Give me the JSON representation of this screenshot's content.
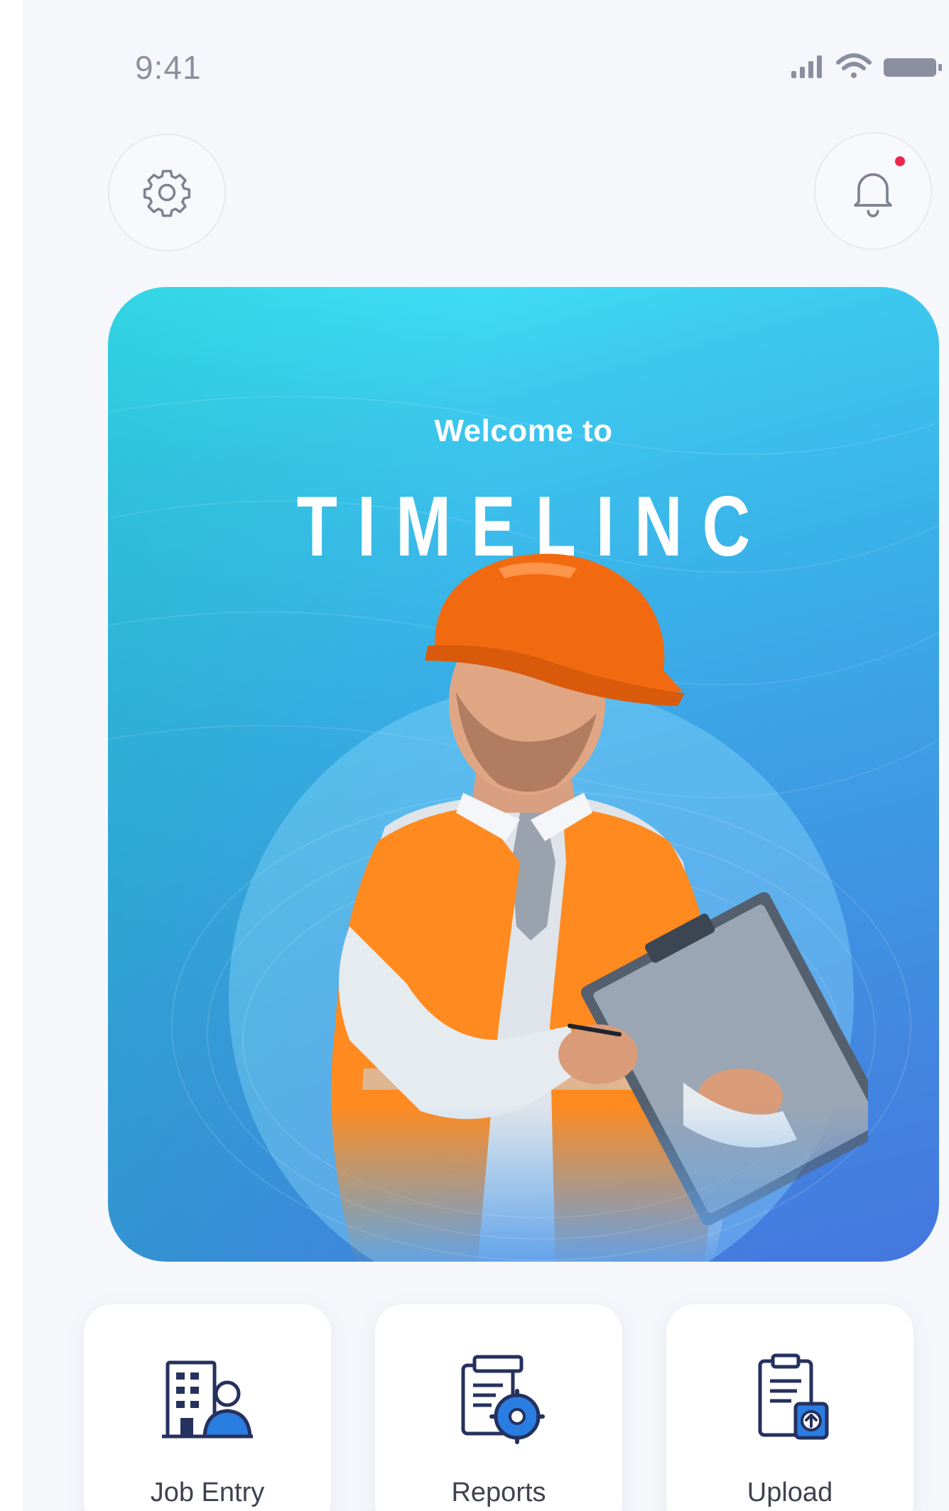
{
  "status_bar": {
    "time": "9:41",
    "icons": [
      "signal-icon",
      "wifi-icon",
      "battery-icon"
    ]
  },
  "header": {
    "left_button_icon": "gear-icon",
    "right_button_icon": "bell-icon",
    "has_notification": true
  },
  "hero": {
    "welcome": "Welcome to",
    "brand": "TIMELINC",
    "image": "construction worker with hard hat and clipboard"
  },
  "tiles": [
    {
      "label": "Job Entry",
      "icon": "job-entry-icon"
    },
    {
      "label": "Reports",
      "icon": "reports-icon"
    },
    {
      "label": "Upload",
      "icon": "upload-icon"
    }
  ],
  "colors": {
    "background": "#f6f7fb",
    "hero_top": "#43ecfb",
    "hero_bottom": "#4577df",
    "notification_dot": "#f0244a",
    "icon_navy": "#25315e",
    "icon_blue": "#2a7de1",
    "label_text": "#3e4250"
  }
}
